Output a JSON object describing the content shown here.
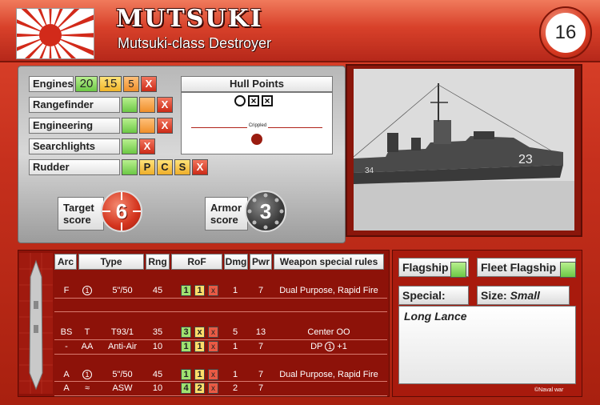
{
  "header": {
    "name": "MUTSUKI",
    "class": "Mutsuki-class Destroyer",
    "points": "16",
    "flag_icon": "rising-sun-flag-icon"
  },
  "systems": [
    {
      "label": "Engines",
      "boxes": [
        {
          "t": "20",
          "c": "green"
        },
        {
          "t": "15",
          "c": "yellow"
        },
        {
          "t": "5",
          "c": "orange"
        },
        {
          "t": "X",
          "c": "red"
        }
      ]
    },
    {
      "label": "Rangefinder",
      "boxes": [
        {
          "t": "",
          "c": "green"
        },
        {
          "t": "",
          "c": "orange"
        },
        {
          "t": "X",
          "c": "red"
        }
      ]
    },
    {
      "label": "Engineering",
      "boxes": [
        {
          "t": "",
          "c": "green"
        },
        {
          "t": "",
          "c": "orange"
        },
        {
          "t": "X",
          "c": "red"
        }
      ]
    },
    {
      "label": "Searchlights",
      "boxes": [
        {
          "t": "",
          "c": "green"
        },
        {
          "t": "X",
          "c": "red"
        }
      ]
    },
    {
      "label": "Rudder",
      "boxes": [
        {
          "t": "",
          "c": "green"
        },
        {
          "t": "P",
          "c": "letter"
        },
        {
          "t": "C",
          "c": "letter"
        },
        {
          "t": "S",
          "c": "letter"
        },
        {
          "t": "X",
          "c": "red"
        }
      ]
    }
  ],
  "hull": {
    "title": "Hull Points",
    "crippled_label": "Crippled"
  },
  "scores": {
    "target_label_1": "Target",
    "target_label_2": "score",
    "target_value": "6",
    "armor_label_1": "Armor",
    "armor_label_2": "score",
    "armor_value": "3"
  },
  "photo": {
    "hull_number": "23",
    "hull_number_2": "34"
  },
  "weapons": {
    "headers": [
      "Arc",
      "Type",
      "Rng",
      "RoF",
      "Dmg",
      "Pwr",
      "Weapon special rules"
    ],
    "rows": [
      {
        "arc": "F",
        "type": "5\"/50",
        "type_icon": "1",
        "rng": "45",
        "rof": [
          {
            "t": "1",
            "c": "g"
          },
          {
            "t": "1",
            "c": "y"
          },
          {
            "t": "x",
            "c": "r"
          }
        ],
        "dmg": "1",
        "pwr": "7",
        "rules": "Dual Purpose, Rapid Fire"
      },
      {
        "arc": "BS",
        "type_code": "T",
        "type": "T93/1",
        "rng": "35",
        "rof": [
          {
            "t": "3",
            "c": "g"
          },
          {
            "t": "x",
            "c": "y"
          },
          {
            "t": "x",
            "c": "r"
          }
        ],
        "dmg": "5",
        "pwr": "13",
        "rules": "Center OO"
      },
      {
        "arc": "-",
        "type_code": "AA",
        "type": "Anti-Air",
        "rng": "10",
        "rof": [
          {
            "t": "1",
            "c": "g"
          },
          {
            "t": "1",
            "c": "y"
          },
          {
            "t": "x",
            "c": "r"
          }
        ],
        "dmg": "1",
        "pwr": "7",
        "rules_pre": "DP",
        "rules_icon": "1",
        "rules_post": "+1"
      },
      {
        "arc": "A",
        "type": "5\"/50",
        "type_icon": "1",
        "rng": "45",
        "rof": [
          {
            "t": "1",
            "c": "g"
          },
          {
            "t": "1",
            "c": "y"
          },
          {
            "t": "x",
            "c": "r"
          }
        ],
        "dmg": "1",
        "pwr": "7",
        "rules": "Dual Purpose, Rapid Fire"
      },
      {
        "arc": "A",
        "type_code": "≈",
        "type": "ASW",
        "rng": "10",
        "rof": [
          {
            "t": "4",
            "c": "g"
          },
          {
            "t": "2",
            "c": "y"
          },
          {
            "t": "x",
            "c": "r"
          }
        ],
        "dmg": "2",
        "pwr": "7",
        "rules": ""
      }
    ]
  },
  "side_panel": {
    "flagship_label": "Flagship",
    "fleet_flagship_label": "Fleet Flagship",
    "special_label": "Special:",
    "size_label": "Size:",
    "size_value": "Small",
    "special_text": "Long Lance"
  },
  "copyright": "©Naval war",
  "colors": {
    "card_red": "#d8412a",
    "green": "#6cc845",
    "yellow": "#f0b52a",
    "dark_red": "#8d1209"
  }
}
